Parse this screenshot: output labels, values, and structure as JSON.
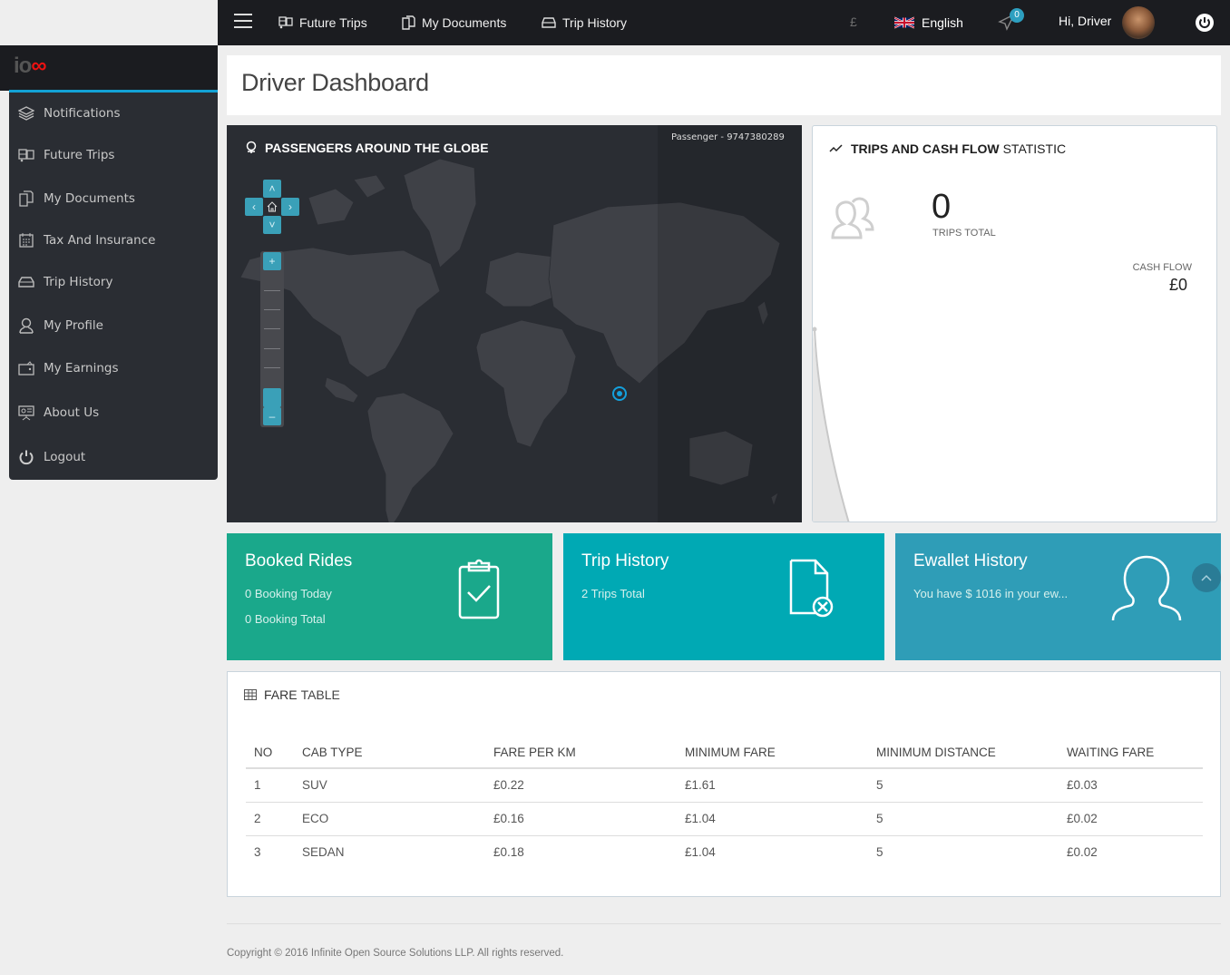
{
  "topbar": {
    "nav": [
      {
        "label": "Future Trips",
        "icon": "bus-icon"
      },
      {
        "label": "My Documents",
        "icon": "documents-icon"
      },
      {
        "label": "Trip History",
        "icon": "car-icon"
      }
    ],
    "currency_symbol": "£",
    "language": "English",
    "notification_count": "0",
    "greeting": "Hi, Driver"
  },
  "sidebar": {
    "items": [
      {
        "label": "Notifications",
        "icon": "layers-icon"
      },
      {
        "label": "Future Trips",
        "icon": "bus-icon"
      },
      {
        "label": "My Documents",
        "icon": "documents-icon"
      },
      {
        "label": "Tax And Insurance",
        "icon": "calendar-icon"
      },
      {
        "label": "Trip History",
        "icon": "car-icon"
      },
      {
        "label": "My Profile",
        "icon": "user-icon"
      },
      {
        "label": "My Earnings",
        "icon": "wallet-icon"
      },
      {
        "label": "About Us",
        "icon": "presentation-icon"
      },
      {
        "label": "Logout",
        "icon": "power-icon"
      }
    ]
  },
  "page": {
    "title": "Driver Dashboard"
  },
  "map": {
    "title": "PASSENGERS AROUND THE GLOBE",
    "passenger_label": "Passenger -  9747380289"
  },
  "stats": {
    "title_bold": "TRIPS AND CASH FLOW",
    "title_rest": "STATISTIC",
    "trips_total": "0",
    "trips_label": "TRIPS TOTAL",
    "cash_label": "CASH FLOW",
    "cash_value": "£0"
  },
  "cards": {
    "booked": {
      "title": "Booked Rides",
      "line1": "0 Booking Today",
      "line2": "0 Booking Total",
      "color": "#1aa88b"
    },
    "trips": {
      "title": "Trip History",
      "line1": "2 Trips Total",
      "color": "#00a9b4"
    },
    "ewallet": {
      "title": "Ewallet History",
      "line1": "You have $ 1016 in your ew...",
      "color": "#2f9db7"
    }
  },
  "fare_table": {
    "title_bold": "FARE",
    "title_rest": "TABLE",
    "headers": [
      "NO",
      "CAB TYPE",
      "FARE PER KM",
      "MINIMUM FARE",
      "MINIMUM DISTANCE",
      "WAITING FARE"
    ],
    "rows": [
      [
        "1",
        "SUV",
        "£0.22",
        "£1.61",
        "5",
        "£0.03"
      ],
      [
        "2",
        "ECO",
        "£0.16",
        "£1.04",
        "5",
        "£0.02"
      ],
      [
        "3",
        "SEDAN",
        "£0.18",
        "£1.04",
        "5",
        "£0.02"
      ]
    ]
  },
  "footer": {
    "copyright": "Copyright © 2016 Infinite Open Source Solutions LLP. All rights reserved."
  }
}
